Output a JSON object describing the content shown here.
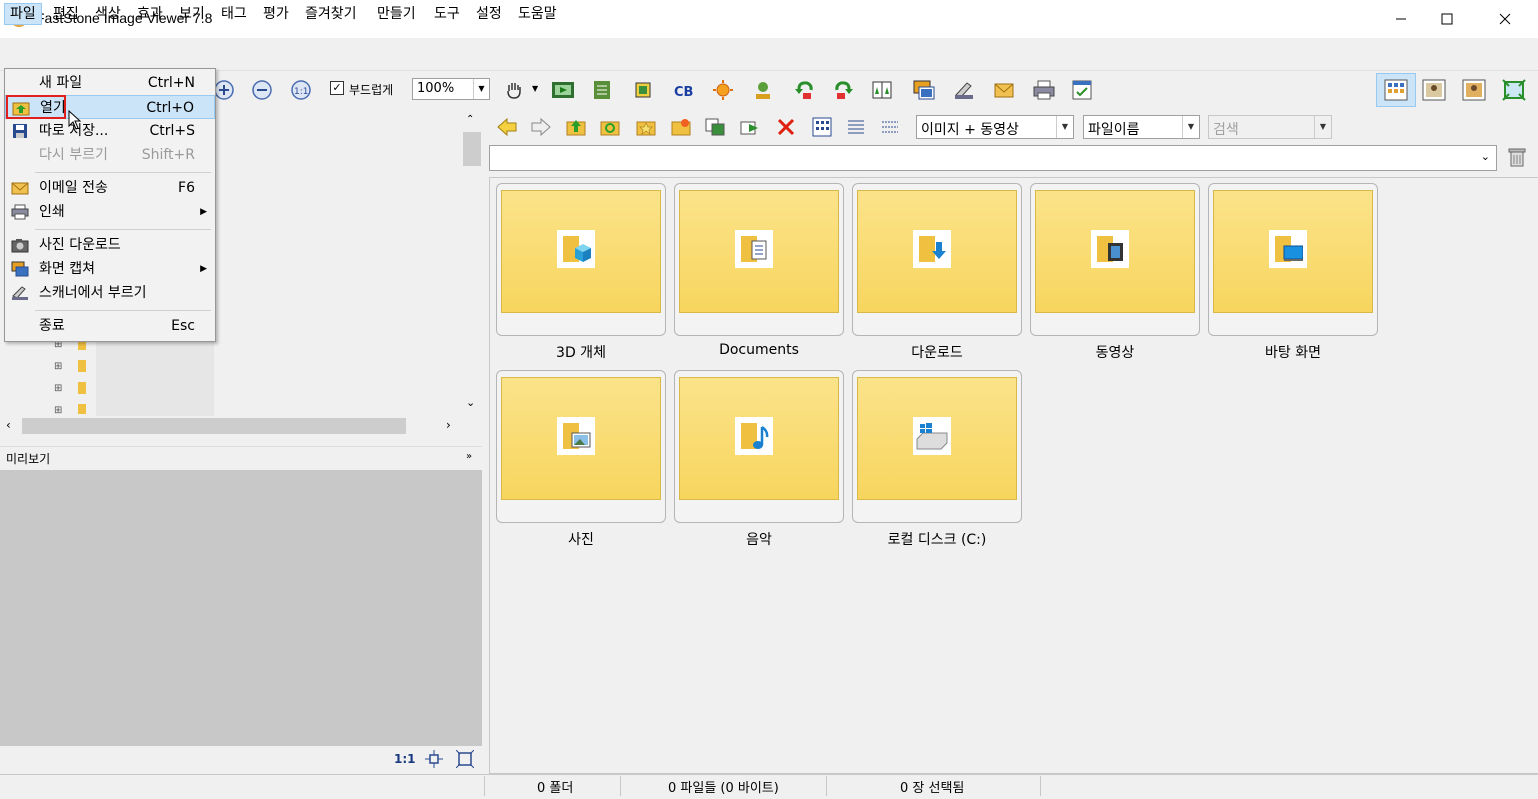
{
  "window": {
    "title": "FastStone Image Viewer 7.8"
  },
  "menubar": {
    "items": [
      "파일",
      "편집",
      "색상",
      "효과",
      "보기",
      "태그",
      "평가",
      "즐겨찾기",
      "만들기",
      "도구",
      "설정",
      "도움말"
    ]
  },
  "toolbar": {
    "smooth_label": "부드럽게",
    "smooth_checked": true,
    "zoom": "100%"
  },
  "file_menu": {
    "items": [
      {
        "label": "새 파일",
        "shortcut": "Ctrl+N"
      },
      {
        "label": "열기",
        "shortcut": "Ctrl+O"
      },
      {
        "label": "따로 저장...",
        "shortcut": "Ctrl+S"
      },
      {
        "label": "다시 부르기",
        "shortcut": "Shift+R"
      },
      {
        "label": "이메일 전송",
        "shortcut": "F6"
      },
      {
        "label": "인쇄",
        "shortcut": ""
      },
      {
        "label": "사진 다운로드",
        "shortcut": ""
      },
      {
        "label": "화면 캡쳐",
        "shortcut": ""
      },
      {
        "label": "스캐너에서 부르기",
        "shortcut": ""
      },
      {
        "label": "종료",
        "shortcut": "Esc"
      }
    ]
  },
  "nav": {
    "filter": "이미지 + 동영상",
    "sort": "파일이름",
    "search_placeholder": "검색"
  },
  "preview": {
    "label": "미리보기",
    "ratio": "1:1"
  },
  "folders": [
    {
      "label": "3D 개체",
      "icon": "3d-objects-icon"
    },
    {
      "label": "Documents",
      "icon": "documents-icon"
    },
    {
      "label": "다운로드",
      "icon": "downloads-icon"
    },
    {
      "label": "동영상",
      "icon": "videos-icon"
    },
    {
      "label": "바탕 화면",
      "icon": "desktop-icon"
    },
    {
      "label": "사진",
      "icon": "pictures-icon"
    },
    {
      "label": "음악",
      "icon": "music-icon"
    },
    {
      "label": "로컬 디스크 (C:)",
      "icon": "local-disk-icon"
    }
  ],
  "status": {
    "folders": "0 폴더",
    "files": "0 파일들 (0 바이트)",
    "selected": "0 장 선택됨"
  }
}
